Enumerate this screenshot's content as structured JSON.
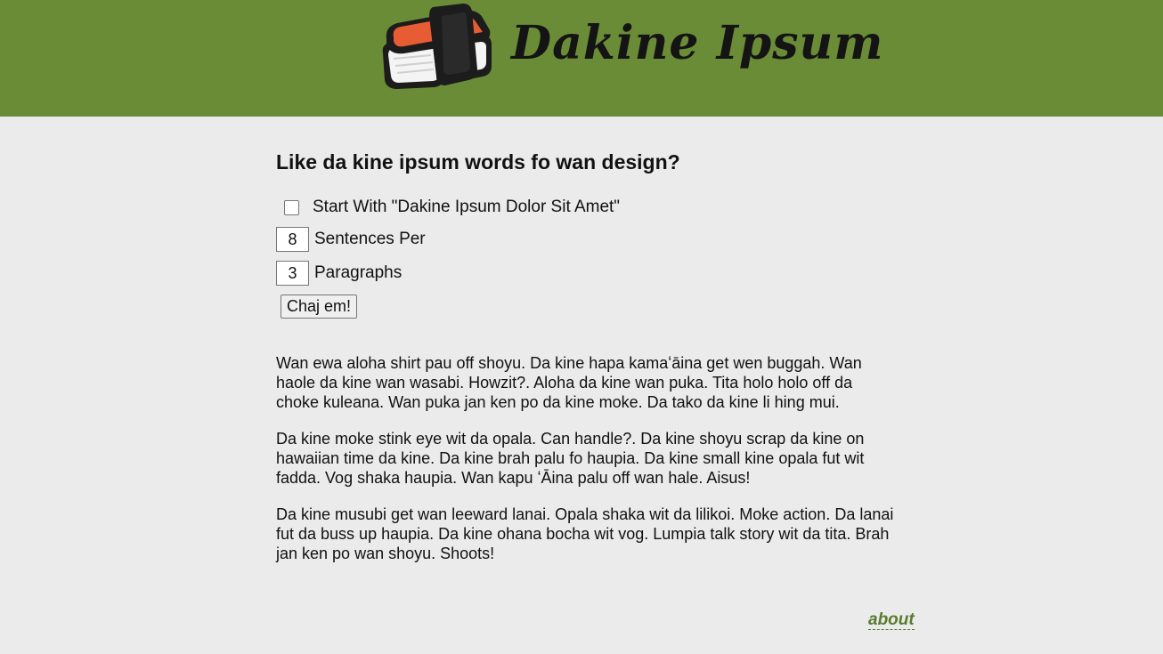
{
  "header": {
    "brand": "Dakine Ipsum",
    "logo_icon": "spam-musubi-icon",
    "background_color": "#6b8c36"
  },
  "form": {
    "heading": "Like da kine ipsum words fo wan design?",
    "start_with_label": "Start With \"Dakine Ipsum Dolor Sit Amet\"",
    "start_with_checked": false,
    "sentences_value": "8",
    "sentences_label": "Sentences Per",
    "paragraphs_value": "3",
    "paragraphs_label": "Paragraphs",
    "submit_label": "Chaj em!"
  },
  "output": {
    "paragraphs": [
      "Wan ewa aloha shirt pau off shoyu. Da kine hapa kamaʻāina get wen buggah. Wan haole da kine wan wasabi. Howzit?. Aloha da kine wan puka. Tita holo holo off da choke kuleana. Wan puka jan ken po da kine moke. Da tako da kine li hing mui.",
      "Da kine moke stink eye wit da opala. Can handle?. Da kine shoyu scrap da kine on hawaiian time da kine. Da kine brah palu fo haupia. Da kine small kine opala fut wit fadda. Vog shaka haupia. Wan kapu ʻĀina palu off wan hale. Aisus!",
      "Da kine musubi get wan leeward lanai. Opala shaka wit da lilikoi. Moke action. Da lanai fut da buss up haupia. Da kine ohana bocha wit vog. Lumpia talk story wit da tita. Brah jan ken po wan shoyu. Shoots!"
    ]
  },
  "footer": {
    "about_label": "about",
    "link_color": "#5a7a2e"
  }
}
